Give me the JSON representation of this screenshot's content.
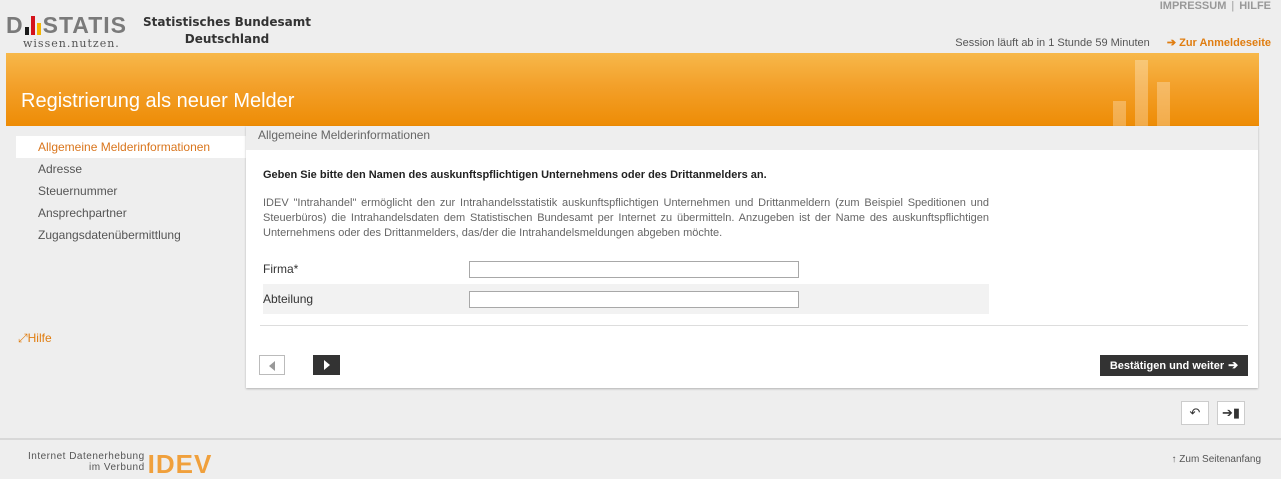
{
  "header": {
    "logo_word": "STATIS",
    "logo_letter": "D",
    "logo_tagline": "wissen.nutzen.",
    "org_line1": "Statistisches Bundesamt",
    "org_line2": "Deutschland",
    "link_impressum": "IMPRESSUM",
    "link_separator": "|",
    "link_help": "HILFE",
    "session_text": "Session läuft ab in 1 Stunde 59 Minuten",
    "login_link": "Zur Anmeldeseite"
  },
  "banner": {
    "title": "Registrierung als neuer Melder"
  },
  "sidebar": {
    "items": [
      {
        "label": "Allgemeine Melderinformationen",
        "active": true
      },
      {
        "label": "Adresse",
        "active": false
      },
      {
        "label": "Steuernummer",
        "active": false
      },
      {
        "label": "Ansprechpartner",
        "active": false
      },
      {
        "label": "Zugangsdatenübermittlung",
        "active": false
      }
    ],
    "help_label": "Hilfe"
  },
  "main": {
    "crumb": "Allgemeine Melderinformationen",
    "question": "Geben Sie bitte den Namen des auskunftspflichtigen Unternehmens oder des Drittanmelders an.",
    "description": "IDEV \"Intrahandel\" ermöglicht den zur Intrahandelsstatistik auskunftspflichtigen Unternehmen und Drittanmeldern (zum Beispiel Speditionen und Steuerbüros) die Intrahandelsdaten dem Statistischen Bundesamt per Internet zu übermitteln. Anzugeben ist der Name des auskunftspflichtigen Unternehmens oder des Drittanmelders, das/der die Intrahandelsmeldungen abgeben möchte.",
    "fields": {
      "firma_label": "Firma*",
      "firma_value": "",
      "abteilung_label": "Abteilung",
      "abteilung_value": ""
    },
    "confirm_label": "Bestätigen und weiter"
  },
  "footer": {
    "logo_line1": "Internet Datenerhebung",
    "logo_line2": "im Verbund",
    "logo_big": "IDEV",
    "to_top": "Zum Seitenanfang"
  },
  "colors": {
    "accent": "#ee8c05",
    "link_orange": "#e07d10",
    "dark_button": "#333333"
  }
}
